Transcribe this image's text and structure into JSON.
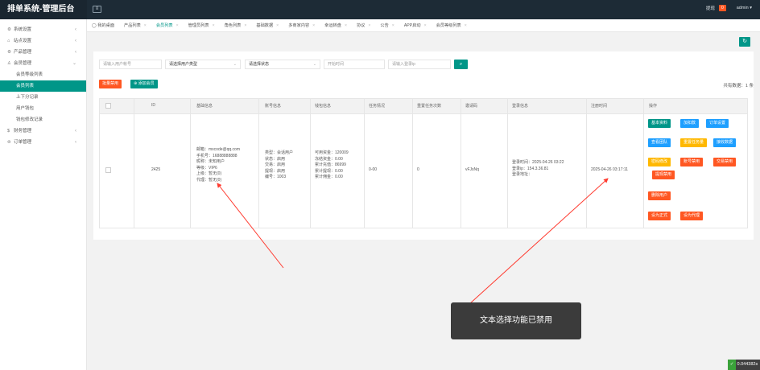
{
  "topbar": {
    "title": "排单系统-管理后台",
    "user_badge_label": "提现",
    "user_badge_count": "0",
    "user": "admin ▾"
  },
  "sidebar": {
    "items": [
      {
        "label": "系统设置",
        "icon": "gear-icon"
      },
      {
        "label": "站点设置",
        "icon": "home-icon"
      },
      {
        "label": "产品管理",
        "icon": "gear-icon"
      },
      {
        "label": "会员管理",
        "icon": "user-icon"
      }
    ],
    "subitems": [
      "会员等级列表",
      "会员列表",
      "上下分记录",
      "用户钱包",
      "钱包修改记录"
    ],
    "bottom_items": [
      {
        "label": "财务管理",
        "icon": "money-icon"
      },
      {
        "label": "订单管理",
        "icon": "order-icon"
      }
    ]
  },
  "tabs": [
    "我的桌面",
    "产品列表",
    "会员列表",
    "管理员列表",
    "角色列表",
    "基础数据",
    "多商家内容",
    "幸运转盘",
    "协议",
    "公告",
    "APP启动",
    "会员等级列表"
  ],
  "filters": {
    "account": "请输入用户帐号",
    "user_type": "请选择用户类型",
    "status": "请选择状态",
    "time": "开始时间",
    "ip": "请输入登录ip"
  },
  "toolbar": {
    "batch_ban": "批量禁用",
    "add_member": "添加会员",
    "total_label": "共有数据：1 条"
  },
  "table": {
    "headers": [
      "ID",
      "基础信息",
      "账号信息",
      "钱包信息",
      "任务情况",
      "重置任务次数",
      "邀请码",
      "登录信息",
      "注册时间",
      "操作"
    ],
    "row": {
      "id": "2425",
      "basic": [
        "邮箱：mxcode@qq.com",
        "手机号：16888888888",
        "昵称：未知用户",
        "等级：VIP6",
        "上级：暂无(0)",
        "代理：暂无(0)"
      ],
      "account": [
        "类型：会话用户",
        "状态：启用",
        "交易：启用",
        "提现：启用",
        "编号：1003"
      ],
      "wallet": [
        "可用资金：120009",
        "冻结资金：0.00",
        "累计充值：86999",
        "累计提现：0.00",
        "累计佣金：0.00"
      ],
      "task": "0-00",
      "reset": "0",
      "invite": "vFJsNq",
      "login": [
        "登录时间：2025-04-26 03:22",
        "登录ip：154.3.36.81",
        "登录地址："
      ],
      "reg_time": "2025-04-26 03:17:11",
      "actions": {
        "basic_info": "基本资料",
        "add_funds": "加扣款",
        "order_settings": "订单设置",
        "view_team": "查看团队",
        "reset_tasks": "重置任务量",
        "receive_data": "接收数据",
        "change_pwd": "密码修改",
        "account_disable": "账号禁用",
        "trade_disable": "交易禁用",
        "withdraw_disable": "提现禁用",
        "delete_user": "删除用户",
        "set_official": "设为正式",
        "set_agent": "设为代理"
      }
    }
  },
  "toast": "文本选择功能已禁用",
  "timer": "0.044382s",
  "colors": {
    "primary": "#009688",
    "danger": "#ff5722",
    "info": "#1e9fff",
    "warn": "#ffb800",
    "topbar": "#1d2b36"
  }
}
